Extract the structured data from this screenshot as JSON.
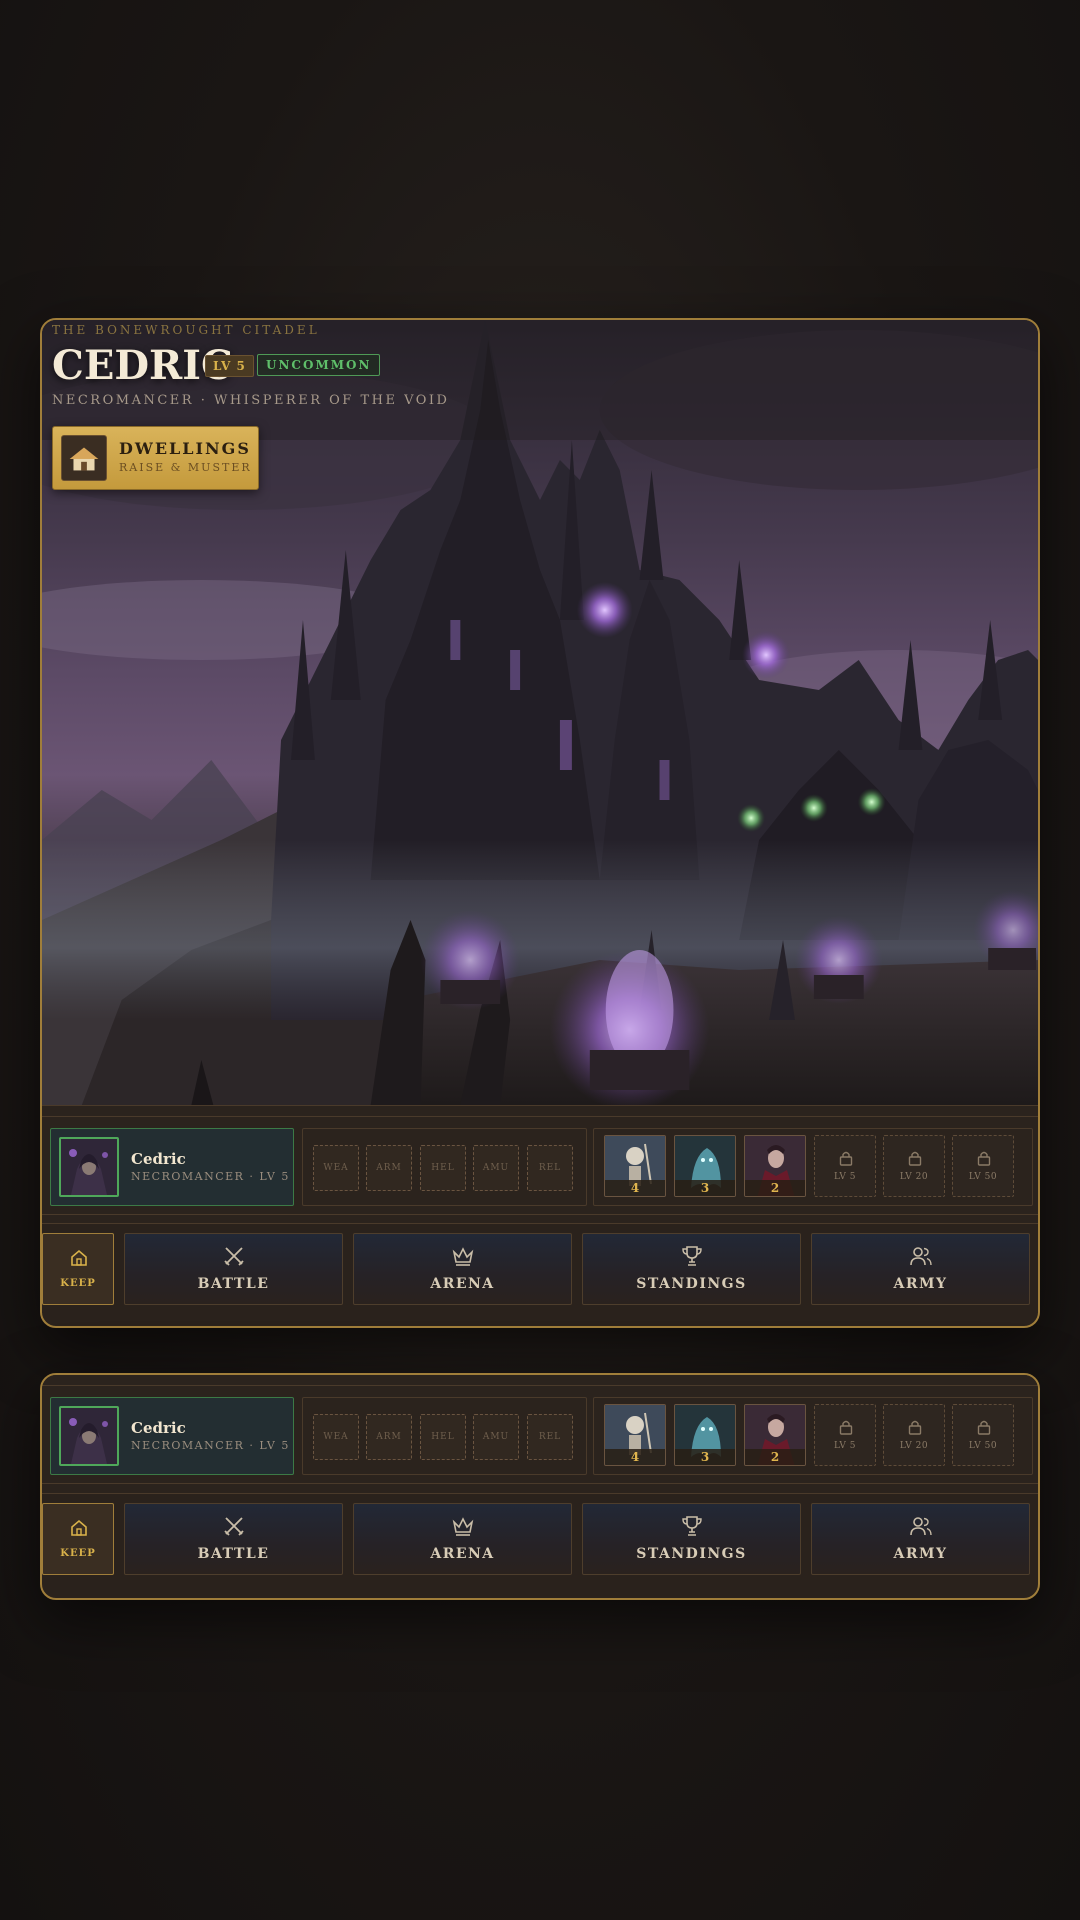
{
  "location": {
    "realm": "THE BONEWROUGHT CITADEL",
    "hero_name": "CEDRIC",
    "level_badge": "LV 5",
    "rarity": "UNCOMMON",
    "subtitle": "NECROMANCER · WHISPERER OF THE VOID"
  },
  "dwellings_button": {
    "title": "DWELLINGS",
    "subtitle": "RAISE & MUSTER",
    "icon": "hut-icon"
  },
  "hero_card": {
    "name": "Cedric",
    "subtitle": "NECROMANCER · LV 5"
  },
  "equipment_slots": [
    "WEA",
    "ARM",
    "HEL",
    "AMU",
    "REL"
  ],
  "army_units": [
    {
      "icon": "skeleton-warrior",
      "count": "4"
    },
    {
      "icon": "ghost-wraith",
      "count": "3"
    },
    {
      "icon": "vampire",
      "count": "2"
    }
  ],
  "locked_slots": [
    "LV 5",
    "LV 20",
    "LV 50"
  ],
  "nav": {
    "keep": "KEEP",
    "battle": "BATTLE",
    "arena": "ARENA",
    "standings": "STANDINGS",
    "army": "ARMY"
  },
  "colors": {
    "gold_accent": "#d9b24a",
    "frame_gold": "#a07e3a",
    "rarity_green": "#5fbf6a",
    "purple_flame": "#b07ae0"
  }
}
